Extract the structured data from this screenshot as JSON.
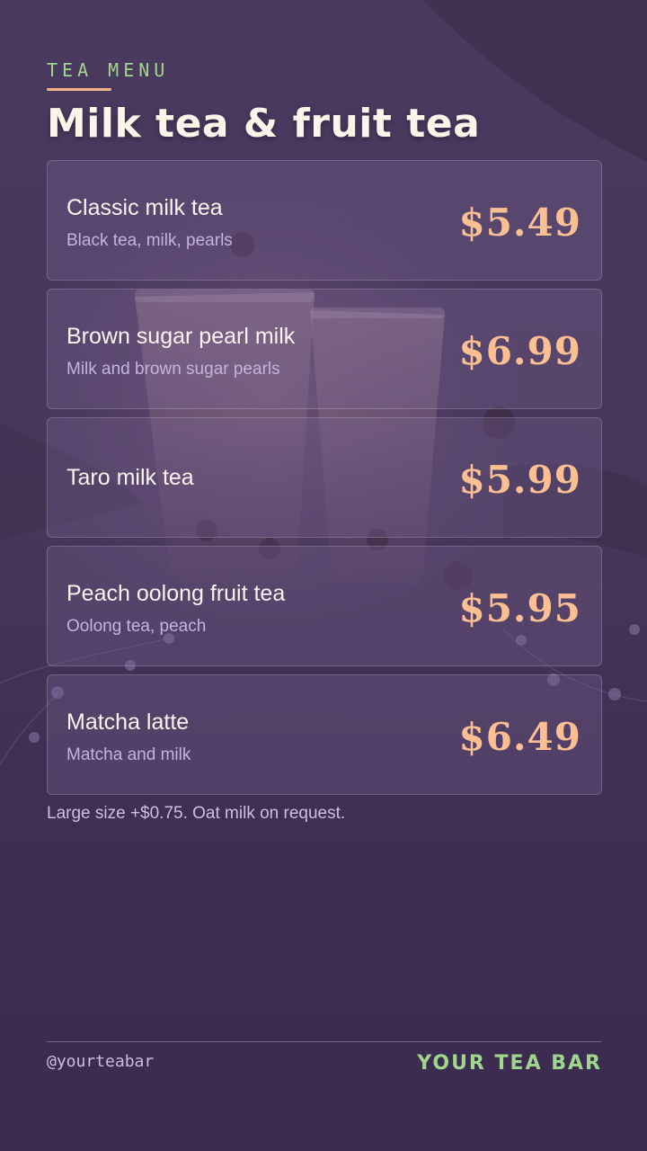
{
  "header": {
    "kicker": "TEA MENU",
    "title": "Milk tea & fruit tea"
  },
  "menu": {
    "items": [
      {
        "name": "Classic milk tea",
        "description": "Black tea, milk, pearls",
        "price": "$5.49"
      },
      {
        "name": "Brown sugar pearl milk",
        "description": "Milk and brown sugar pearls",
        "price": "$6.99"
      },
      {
        "name": "Taro milk tea",
        "description": "",
        "price": "$5.99"
      },
      {
        "name": "Peach oolong fruit tea",
        "description": "Oolong tea, peach",
        "price": "$5.95"
      },
      {
        "name": "Matcha latte",
        "description": "Matcha and milk",
        "price": "$6.49"
      }
    ]
  },
  "note": "Large size +$0.75. Oat milk on request.",
  "footer": {
    "handle": "@yourteabar",
    "brand": "YOUR TEA BAR"
  },
  "colors": {
    "background": "#3f2f55",
    "accent_green": "#9fd68b",
    "accent_peach": "#fbbf92",
    "title": "#fff3ea"
  }
}
